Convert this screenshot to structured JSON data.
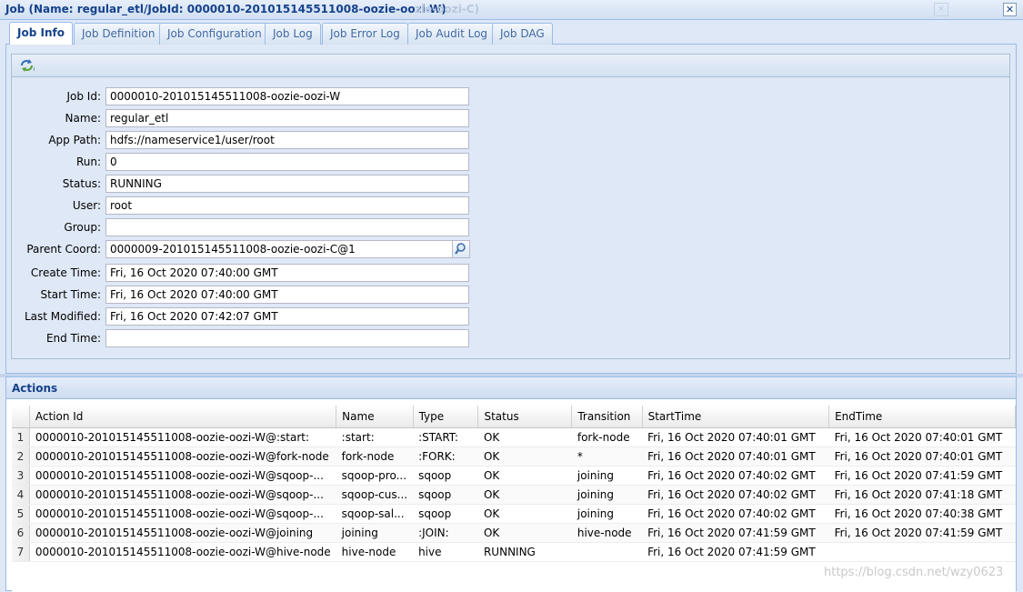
{
  "window": {
    "title": "Job (Name: regular_etl/JobId: 0000010-201015145511008-oozie-oozi-W)",
    "title_ghost": "zie-oozi-C)",
    "close_glyph": "✕"
  },
  "tabs": [
    {
      "label": "Job Info",
      "active": true
    },
    {
      "label": "Job Definition",
      "active": false
    },
    {
      "label": "Job Configuration",
      "active": false
    },
    {
      "label": "Job Log",
      "active": false
    },
    {
      "label": "Job Error Log",
      "active": false
    },
    {
      "label": "Job Audit Log",
      "active": false
    },
    {
      "label": "Job DAG",
      "active": false
    }
  ],
  "toolbar": {
    "refresh_icon": "refresh-icon"
  },
  "fields": {
    "job_id": {
      "label": "Job Id:",
      "value": "0000010-201015145511008-oozie-oozi-W"
    },
    "name": {
      "label": "Name:",
      "value": "regular_etl"
    },
    "app_path": {
      "label": "App Path:",
      "value": "hdfs://nameservice1/user/root"
    },
    "run": {
      "label": "Run:",
      "value": "0"
    },
    "status": {
      "label": "Status:",
      "value": "RUNNING"
    },
    "user": {
      "label": "User:",
      "value": "root"
    },
    "group": {
      "label": "Group:",
      "value": ""
    },
    "parent_coord": {
      "label": "Parent Coord:",
      "value": "0000009-201015145511008-oozie-oozi-C@1"
    },
    "create_time": {
      "label": "Create Time:",
      "value": "Fri, 16 Oct 2020 07:40:00 GMT"
    },
    "start_time": {
      "label": "Start Time:",
      "value": "Fri, 16 Oct 2020 07:40:00 GMT"
    },
    "last_modified": {
      "label": "Last Modified:",
      "value": "Fri, 16 Oct 2020 07:42:07 GMT"
    },
    "end_time": {
      "label": "End Time:",
      "value": ""
    }
  },
  "actions": {
    "title": "Actions",
    "columns": [
      "Action Id",
      "Name",
      "Type",
      "Status",
      "Transition",
      "StartTime",
      "EndTime"
    ],
    "rows": [
      {
        "n": "1",
        "action_id": "0000010-201015145511008-oozie-oozi-W@:start:",
        "name": ":start:",
        "type": ":START:",
        "status": "OK",
        "transition": "fork-node",
        "start": "Fri, 16 Oct 2020 07:40:01 GMT",
        "end": "Fri, 16 Oct 2020 07:40:01 GMT"
      },
      {
        "n": "2",
        "action_id": "0000010-201015145511008-oozie-oozi-W@fork-node",
        "name": "fork-node",
        "type": ":FORK:",
        "status": "OK",
        "transition": "*",
        "start": "Fri, 16 Oct 2020 07:40:01 GMT",
        "end": "Fri, 16 Oct 2020 07:40:01 GMT"
      },
      {
        "n": "3",
        "action_id": "0000010-201015145511008-oozie-oozi-W@sqoop-...",
        "name": "sqoop-pro...",
        "type": "sqoop",
        "status": "OK",
        "transition": "joining",
        "start": "Fri, 16 Oct 2020 07:40:02 GMT",
        "end": "Fri, 16 Oct 2020 07:41:59 GMT"
      },
      {
        "n": "4",
        "action_id": "0000010-201015145511008-oozie-oozi-W@sqoop-...",
        "name": "sqoop-cus...",
        "type": "sqoop",
        "status": "OK",
        "transition": "joining",
        "start": "Fri, 16 Oct 2020 07:40:02 GMT",
        "end": "Fri, 16 Oct 2020 07:41:18 GMT"
      },
      {
        "n": "5",
        "action_id": "0000010-201015145511008-oozie-oozi-W@sqoop-...",
        "name": "sqoop-sal...",
        "type": "sqoop",
        "status": "OK",
        "transition": "joining",
        "start": "Fri, 16 Oct 2020 07:40:02 GMT",
        "end": "Fri, 16 Oct 2020 07:40:38 GMT"
      },
      {
        "n": "6",
        "action_id": "0000010-201015145511008-oozie-oozi-W@joining",
        "name": "joining",
        "type": ":JOIN:",
        "status": "OK",
        "transition": "hive-node",
        "start": "Fri, 16 Oct 2020 07:41:59 GMT",
        "end": "Fri, 16 Oct 2020 07:41:59 GMT"
      },
      {
        "n": "7",
        "action_id": "0000010-201015145511008-oozie-oozi-W@hive-node",
        "name": "hive-node",
        "type": "hive",
        "status": "RUNNING",
        "transition": "",
        "start": "Fri, 16 Oct 2020 07:41:59 GMT",
        "end": ""
      }
    ]
  },
  "watermark": "https://blog.csdn.net/wzy0623"
}
